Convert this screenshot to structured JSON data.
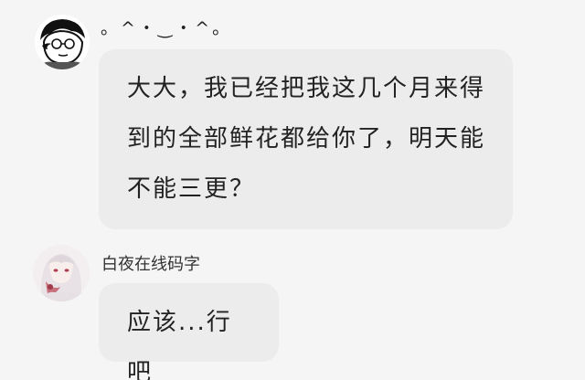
{
  "messages": [
    {
      "sender": "。^・‿・^。",
      "avatar_icon": "cartoon-face-avatar-icon",
      "text": "大大，我已经把我这几个月来得到的全部鲜花都给你了，明天能不能三更？"
    },
    {
      "sender": "白夜在线码字",
      "avatar_icon": "anime-girl-avatar-icon",
      "text": "应该...行吧"
    }
  ],
  "colors": {
    "background": "#f5f5f5",
    "bubble": "#ececec",
    "text": "#222222"
  }
}
